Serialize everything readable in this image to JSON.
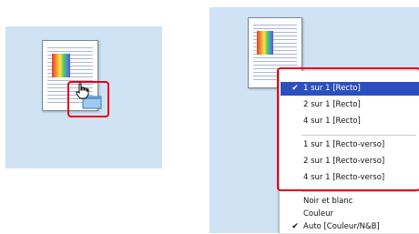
{
  "layout_menu": {
    "items": [
      {
        "label": "1 sur 1 [Recto]",
        "checked": true,
        "selected": true
      },
      {
        "label": "2 sur 1 [Recto]",
        "checked": false,
        "selected": false
      },
      {
        "label": "4 sur 1 [Recto]",
        "checked": false,
        "selected": false
      },
      {
        "label": "1 sur 1 [Recto-verso]",
        "checked": false,
        "selected": false
      },
      {
        "label": "2 sur 1 [Recto-verso]",
        "checked": false,
        "selected": false
      },
      {
        "label": "4 sur 1 [Recto-verso]",
        "checked": false,
        "selected": false
      }
    ]
  },
  "color_menu": {
    "items": [
      {
        "label": "Noir et blanc",
        "checked": false
      },
      {
        "label": "Couleur",
        "checked": false
      },
      {
        "label": "Auto [Couleur/N&B]",
        "checked": true
      }
    ]
  },
  "checkmark": "✔",
  "colors": {
    "panel_bg": "#cfe3f5",
    "highlight": "#e60012",
    "selection": "#2b4fbd"
  },
  "icons": [
    "hand-cursor-icon",
    "document-icon",
    "check-icon"
  ]
}
